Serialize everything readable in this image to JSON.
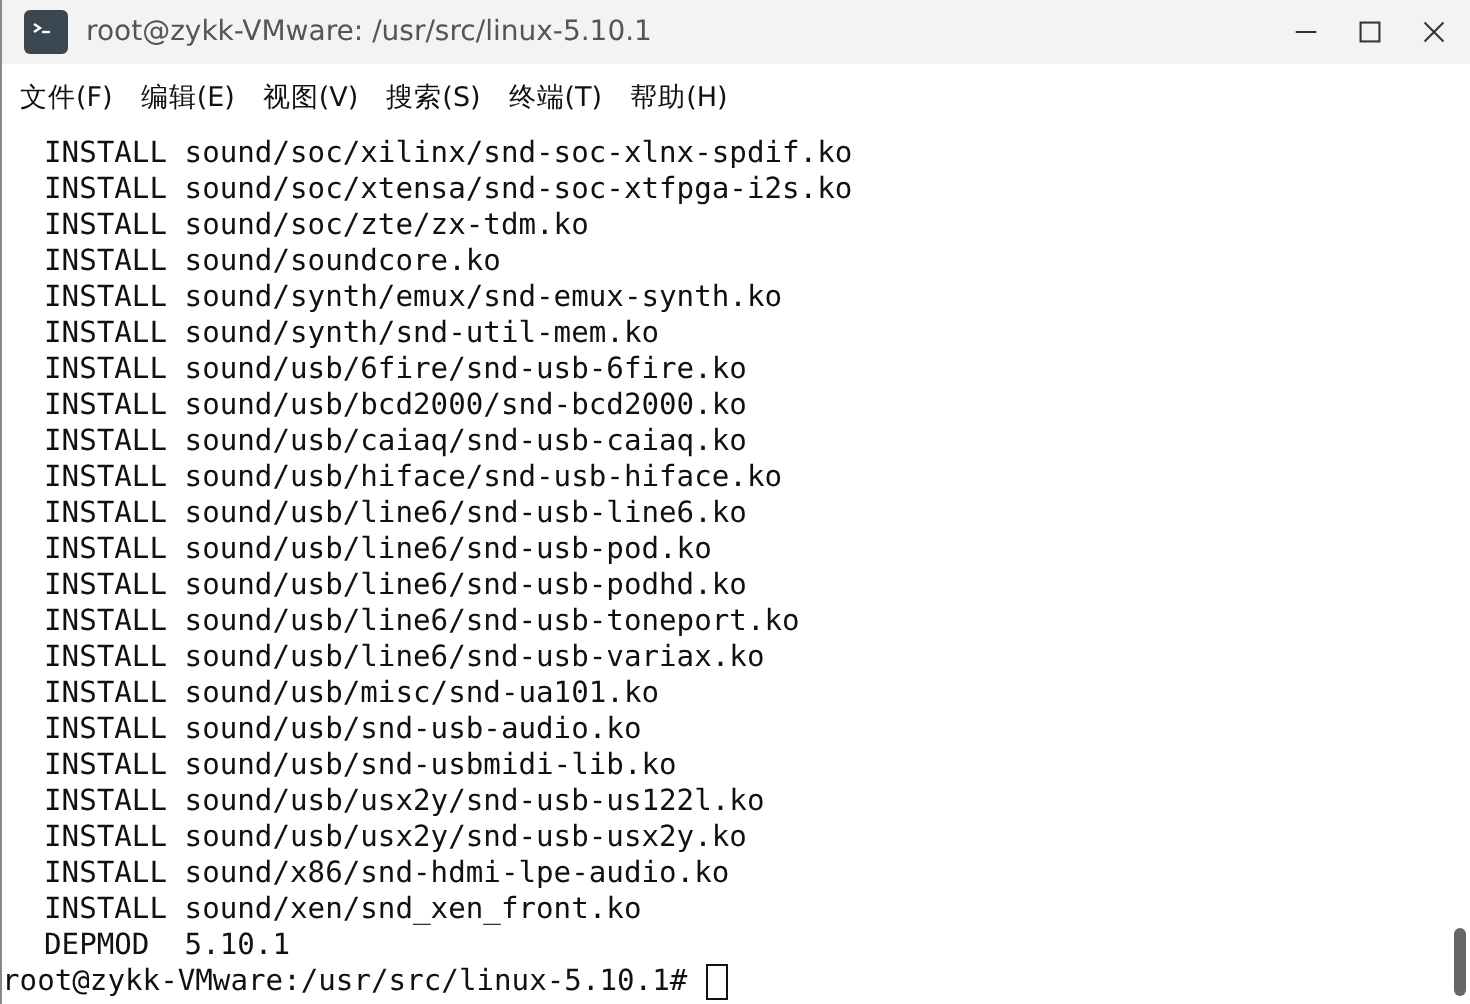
{
  "window": {
    "title": "root@zykk-VMware: /usr/src/linux-5.10.1"
  },
  "menu": [
    "文件(F)",
    "编辑(E)",
    "视图(V)",
    "搜索(S)",
    "终端(T)",
    "帮助(H)"
  ],
  "terminal": {
    "lines": [
      {
        "kind": "output",
        "text": "INSTALL sound/soc/xilinx/snd-soc-xlnx-spdif.ko"
      },
      {
        "kind": "output",
        "text": "INSTALL sound/soc/xtensa/snd-soc-xtfpga-i2s.ko"
      },
      {
        "kind": "output",
        "text": "INSTALL sound/soc/zte/zx-tdm.ko"
      },
      {
        "kind": "output",
        "text": "INSTALL sound/soundcore.ko"
      },
      {
        "kind": "output",
        "text": "INSTALL sound/synth/emux/snd-emux-synth.ko"
      },
      {
        "kind": "output",
        "text": "INSTALL sound/synth/snd-util-mem.ko"
      },
      {
        "kind": "output",
        "text": "INSTALL sound/usb/6fire/snd-usb-6fire.ko"
      },
      {
        "kind": "output",
        "text": "INSTALL sound/usb/bcd2000/snd-bcd2000.ko"
      },
      {
        "kind": "output",
        "text": "INSTALL sound/usb/caiaq/snd-usb-caiaq.ko"
      },
      {
        "kind": "output",
        "text": "INSTALL sound/usb/hiface/snd-usb-hiface.ko"
      },
      {
        "kind": "output",
        "text": "INSTALL sound/usb/line6/snd-usb-line6.ko"
      },
      {
        "kind": "output",
        "text": "INSTALL sound/usb/line6/snd-usb-pod.ko"
      },
      {
        "kind": "output",
        "text": "INSTALL sound/usb/line6/snd-usb-podhd.ko"
      },
      {
        "kind": "output",
        "text": "INSTALL sound/usb/line6/snd-usb-toneport.ko"
      },
      {
        "kind": "output",
        "text": "INSTALL sound/usb/line6/snd-usb-variax.ko"
      },
      {
        "kind": "output",
        "text": "INSTALL sound/usb/misc/snd-ua101.ko"
      },
      {
        "kind": "output",
        "text": "INSTALL sound/usb/snd-usb-audio.ko"
      },
      {
        "kind": "output",
        "text": "INSTALL sound/usb/snd-usbmidi-lib.ko"
      },
      {
        "kind": "output",
        "text": "INSTALL sound/usb/usx2y/snd-usb-us122l.ko"
      },
      {
        "kind": "output",
        "text": "INSTALL sound/usb/usx2y/snd-usb-usx2y.ko"
      },
      {
        "kind": "output",
        "text": "INSTALL sound/x86/snd-hdmi-lpe-audio.ko"
      },
      {
        "kind": "output",
        "text": "INSTALL sound/xen/snd_xen_front.ko"
      },
      {
        "kind": "output",
        "text": "DEPMOD  5.10.1"
      },
      {
        "kind": "prompt",
        "text": "root@zykk-VMware:/usr/src/linux-5.10.1#"
      }
    ]
  }
}
